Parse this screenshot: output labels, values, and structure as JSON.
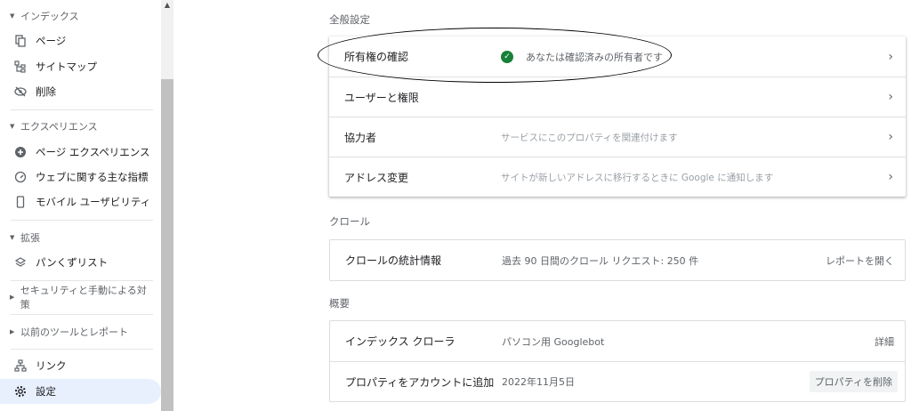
{
  "sidebar": {
    "sections": [
      {
        "label": "インデックス"
      },
      {
        "label": "エクスペリエンス"
      },
      {
        "label": "拡張"
      },
      {
        "label": "セキュリティと手動による対策"
      },
      {
        "label": "以前のツールとレポート"
      }
    ],
    "items": [
      {
        "label": "ページ",
        "icon": "page-icon"
      },
      {
        "label": "サイトマップ",
        "icon": "sitemap-icon"
      },
      {
        "label": "削除",
        "icon": "removal-icon"
      },
      {
        "label": "ページ エクスペリエンス",
        "icon": "page-experience-icon"
      },
      {
        "label": "ウェブに関する主な指標",
        "icon": "gauge-icon"
      },
      {
        "label": "モバイル ユーザビリティ",
        "icon": "mobile-icon"
      },
      {
        "label": "パンくずリスト",
        "icon": "breadcrumb-icon"
      },
      {
        "label": "リンク",
        "icon": "links-icon"
      },
      {
        "label": "設定",
        "icon": "settings-icon"
      }
    ]
  },
  "general": {
    "title": "全般設定",
    "rows": [
      {
        "label": "所有権の確認",
        "value": "あなたは確認済みの所有者です"
      },
      {
        "label": "ユーザーと権限",
        "value": ""
      },
      {
        "label": "協力者",
        "value": "サービスにこのプロパティを関連付けます"
      },
      {
        "label": "アドレス変更",
        "value": "サイトが新しいアドレスに移行するときに Google に通知します"
      }
    ]
  },
  "crawl": {
    "title": "クロール",
    "label": "クロールの統計情報",
    "value": "過去 90 日間のクロール リクエスト: 250 件",
    "action": "レポートを開く"
  },
  "overview": {
    "title": "概要",
    "rows": [
      {
        "label": "インデックス クローラ",
        "value": "パソコン用 Googlebot",
        "action": "詳細"
      },
      {
        "label": "プロパティをアカウントに追加",
        "value": "2022年11月5日",
        "action": "プロパティを削除"
      }
    ]
  },
  "colors": {
    "verified": "#188038",
    "active_bg": "#e8f0fe",
    "annotation": "#000000"
  }
}
